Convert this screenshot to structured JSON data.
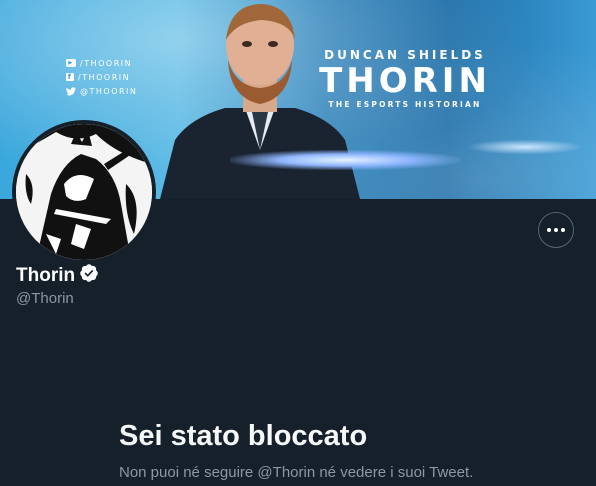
{
  "banner": {
    "socials": [
      {
        "icon": "youtube-icon",
        "text": "/THOORIN"
      },
      {
        "icon": "facebook-icon",
        "text": "/THOORIN"
      },
      {
        "icon": "twitter-icon",
        "text": "@THOORIN"
      }
    ],
    "brand_top": "DUNCAN SHIELDS",
    "brand_name": "THORIN",
    "brand_tagline": "THE ESPORTS HISTORIAN"
  },
  "profile": {
    "display_name": "Thorin",
    "handle": "@Thorin",
    "verified": true
  },
  "blocked": {
    "title": "Sei stato bloccato",
    "message": "Non puoi né seguire @Thorin né vedere i suoi Tweet."
  },
  "colors": {
    "background": "#15202b",
    "secondary_text": "#8b98a5",
    "verified_badge": "#ffffff",
    "banner_accent": "#3aa7dc"
  }
}
